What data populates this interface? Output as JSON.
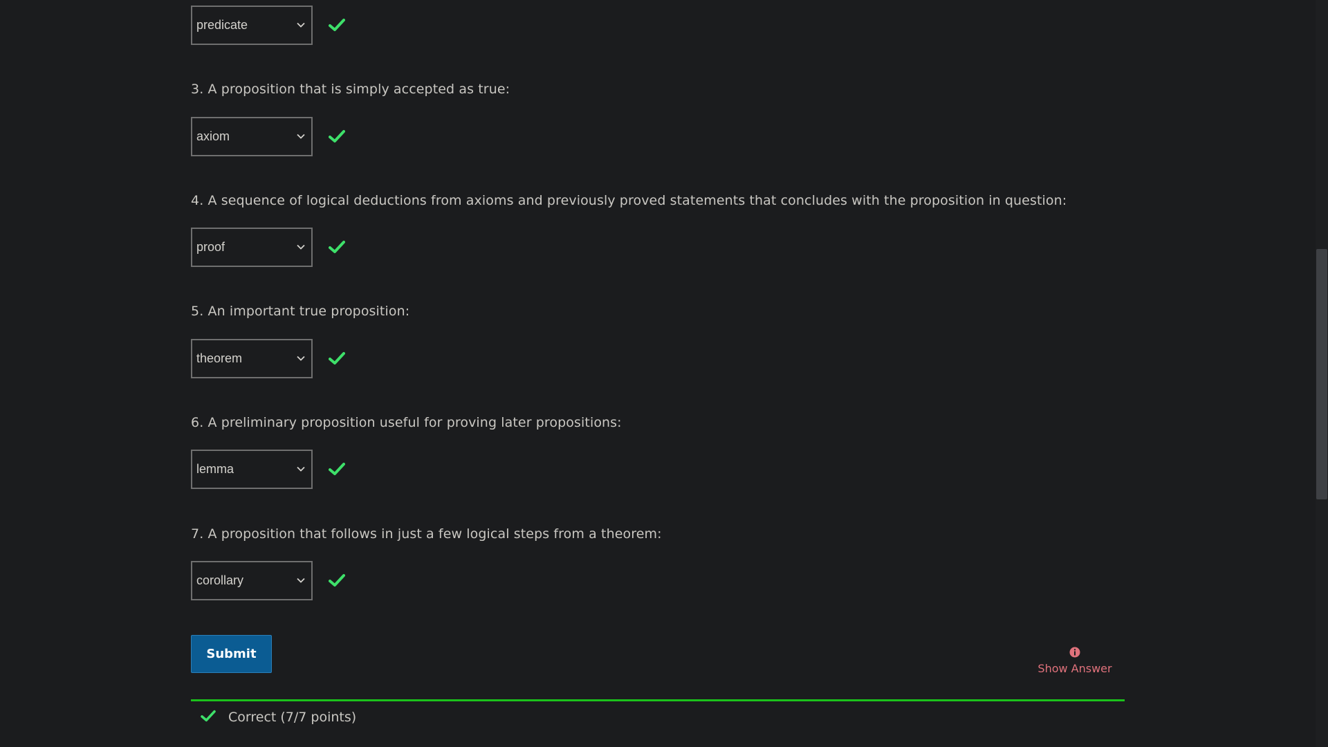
{
  "questions": [
    {
      "prompt": "",
      "answer": "predicate"
    },
    {
      "prompt": "3. A proposition that is simply accepted as true:",
      "answer": "axiom"
    },
    {
      "prompt": "4. A sequence of logical deductions from axioms and previously proved statements that concludes with the proposition in question:",
      "answer": "proof"
    },
    {
      "prompt": "5. An important true proposition:",
      "answer": "theorem"
    },
    {
      "prompt": "6. A preliminary proposition useful for proving later propositions:",
      "answer": "lemma"
    },
    {
      "prompt": "7. A proposition that follows in just a few logical steps from a theorem:",
      "answer": "corollary"
    }
  ],
  "actions": {
    "submit_label": "Submit",
    "show_answer_label": "Show Answer"
  },
  "result": {
    "label": "Correct (7/7 points)"
  },
  "icons": {
    "check": "check-icon",
    "chevron": "chevron-down-icon",
    "info": "info-icon"
  },
  "colors": {
    "background": "#1b1c1e",
    "check": "#3ee06a",
    "submit": "#0b5c93",
    "show_answer": "#e0727c",
    "status_bar": "#1bc11b"
  }
}
